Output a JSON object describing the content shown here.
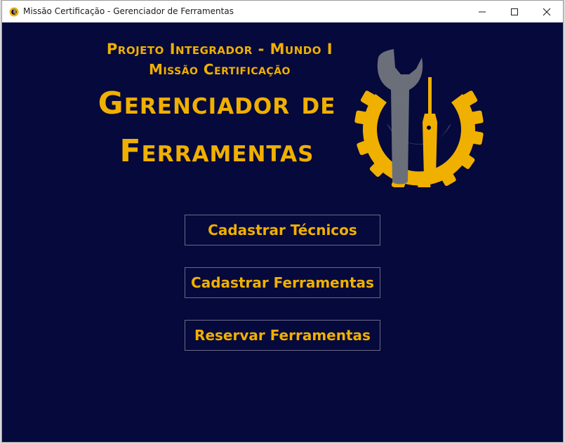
{
  "window": {
    "title": "Missão Certificação - Gerenciador de Ferramentas",
    "icon": "gear-wrench-app-icon",
    "controls": [
      "minimize-icon",
      "maximize-icon",
      "close-icon"
    ]
  },
  "header": {
    "subtitle_line1": "Projeto Integrador - Mundo I",
    "subtitle_line2": "Missão Certificação",
    "title_line1": "Gerenciador de",
    "title_line2": "Ferramentas"
  },
  "logo": {
    "icon": "gear-wrench-screwdriver-logo"
  },
  "menu": {
    "buttons": [
      {
        "label": "Cadastrar Técnicos"
      },
      {
        "label": "Cadastrar Ferramentas"
      },
      {
        "label": "Reservar Ferramentas"
      }
    ]
  },
  "colors": {
    "background": "#06093b",
    "accent": "#f0b000",
    "wrench": "#6b6f7a",
    "button_border": "#6a6a86"
  }
}
